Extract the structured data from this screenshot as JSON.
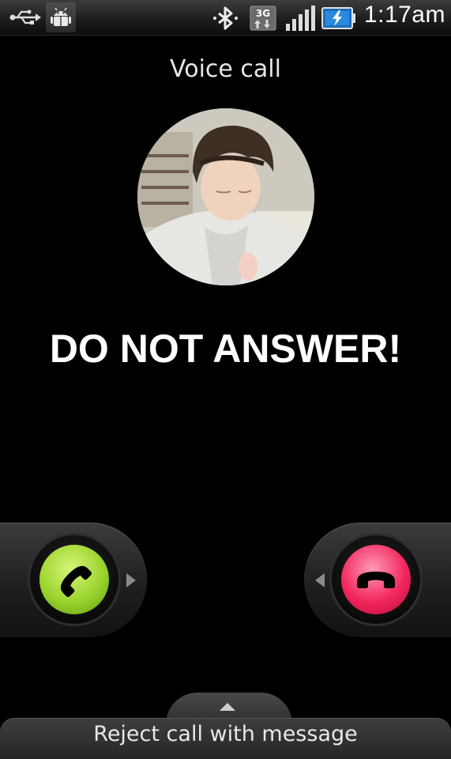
{
  "status_bar": {
    "time": "1:17am",
    "icons": [
      "usb-icon",
      "android-debug-icon",
      "bluetooth-icon",
      "3g-data-icon",
      "signal-strength-icon",
      "battery-charging-icon"
    ]
  },
  "call": {
    "type_label": "Voice call",
    "caller_name": "DO NOT ANSWER!",
    "contact_photo": "contact-photo"
  },
  "actions": {
    "answer": {
      "icon": "phone-answer-icon",
      "color": "#9bd42d"
    },
    "decline": {
      "icon": "phone-hangup-icon",
      "color": "#f2275e"
    },
    "reject_message_label": "Reject call with message"
  }
}
